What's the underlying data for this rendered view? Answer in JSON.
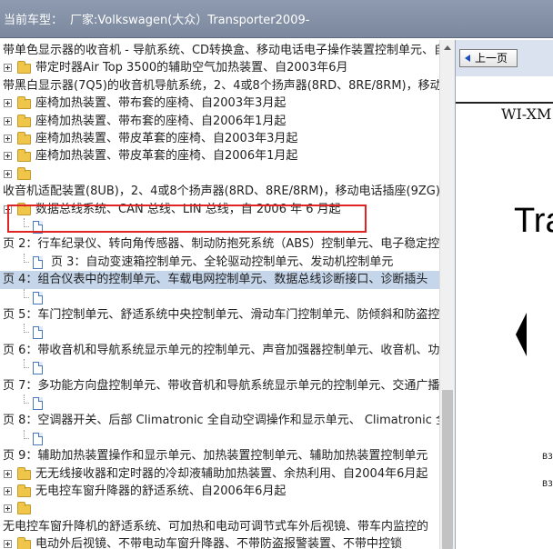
{
  "header": {
    "model_label": "当前车型：",
    "model_value": "厂家:Volkswagen(大众）Transporter2009-"
  },
  "tree": {
    "rows": [
      {
        "type": "text",
        "indent": 0,
        "label": "带单色显示器的收音机 - 导航系统、CD转换盒、移动电话电子操作装置控制单元、自"
      },
      {
        "type": "folder",
        "indent": 1,
        "label": "带定时器Air Top 3500的辅助空气加热装置、自2003年6月"
      },
      {
        "type": "text",
        "indent": 0,
        "label": "带黑白显示器(7Q5)的收音机导航系统，2、4或8个扬声器(8RD、8RE/8RM)，移动电"
      },
      {
        "type": "folder",
        "indent": 1,
        "label": "座椅加热装置、带布套的座椅、自2003年3月起"
      },
      {
        "type": "folder",
        "indent": 1,
        "label": "座椅加热装置、带布套的座椅、自2006年1月起"
      },
      {
        "type": "folder",
        "indent": 1,
        "label": "座椅加热装置、带皮革套的座椅、自2003年3月起"
      },
      {
        "type": "folder",
        "indent": 1,
        "label": "座椅加热装置、带皮革套的座椅、自2006年1月起"
      },
      {
        "type": "folder",
        "indent": 1,
        "label": ""
      },
      {
        "type": "text",
        "indent": 0,
        "label": "收音机适配装置(8UB)，2、4或8个扬声器(8RD、8RE/8RM)，移动电话插座(9ZG))，"
      },
      {
        "type": "folder",
        "indent": 1,
        "label": "数据总线系统、CAN 总线、LIN 总线，自 2006 年 6 月起"
      },
      {
        "type": "doc",
        "indent": 2,
        "label": ""
      },
      {
        "type": "text",
        "indent": 0,
        "label": "页 2：行车纪录仪、转向角传感器、制动防抱死系统（ABS）控制单元、电子稳定控"
      },
      {
        "type": "doc",
        "indent": 2,
        "label": "页 3：自动变速箱控制单元、全轮驱动控制单元、发动机控制单元"
      },
      {
        "type": "text",
        "indent": 0,
        "selected": true,
        "label": "页 4：组合仪表中的控制单元、车载电网控制单元、数据总线诊断接口、诊断插头"
      },
      {
        "type": "doc",
        "indent": 2,
        "label": ""
      },
      {
        "type": "text",
        "indent": 0,
        "label": "页 5：车门控制单元、舒适系统中央控制单元、滑动车门控制单元、防倾斜和防盗控"
      },
      {
        "type": "doc",
        "indent": 2,
        "label": ""
      },
      {
        "type": "text",
        "indent": 0,
        "label": "页 6：带收音机和导航系统显示单元的控制单元、声音加强器控制单元、收音机、功"
      },
      {
        "type": "doc",
        "indent": 2,
        "label": ""
      },
      {
        "type": "text",
        "indent": 0,
        "label": "页 7：多功能方向盘控制单元、带收音机和导航系统显示单元的控制单元、交通广播"
      },
      {
        "type": "doc",
        "indent": 2,
        "label": ""
      },
      {
        "type": "text",
        "indent": 0,
        "label": "页 8：空调器开关、后部 Climatronic 全自动空调操作和显示单元、 Climatronic 全"
      },
      {
        "type": "doc",
        "indent": 2,
        "label": ""
      },
      {
        "type": "text",
        "indent": 0,
        "label": "页 9：辅助加热装置操作和显示单元、加热装置控制单元、辅助加热装置控制单元"
      },
      {
        "type": "folder",
        "indent": 1,
        "label": "无无线接收器和定时器的冷却液辅助加热装置、余热利用、自2004年6月起"
      },
      {
        "type": "folder",
        "indent": 1,
        "label": "无电控车窗升降器的舒适系统、自2006年6月起"
      },
      {
        "type": "folder",
        "indent": 1,
        "label": ""
      },
      {
        "type": "text",
        "indent": 0,
        "label": "无电控车窗升降机的舒适系统、可加热和电动可调节式车外后视镜、带车内监控的"
      },
      {
        "type": "folder",
        "indent": 1,
        "label": "电动外后视镜、不带电动车窗升降器、不带防盗报警装置、不带中控锁"
      }
    ]
  },
  "viewer": {
    "prev_button": "上一页",
    "doc_code": "WI-XM",
    "title_fragment": "Tra",
    "refs": [
      "B3",
      "B3"
    ]
  }
}
